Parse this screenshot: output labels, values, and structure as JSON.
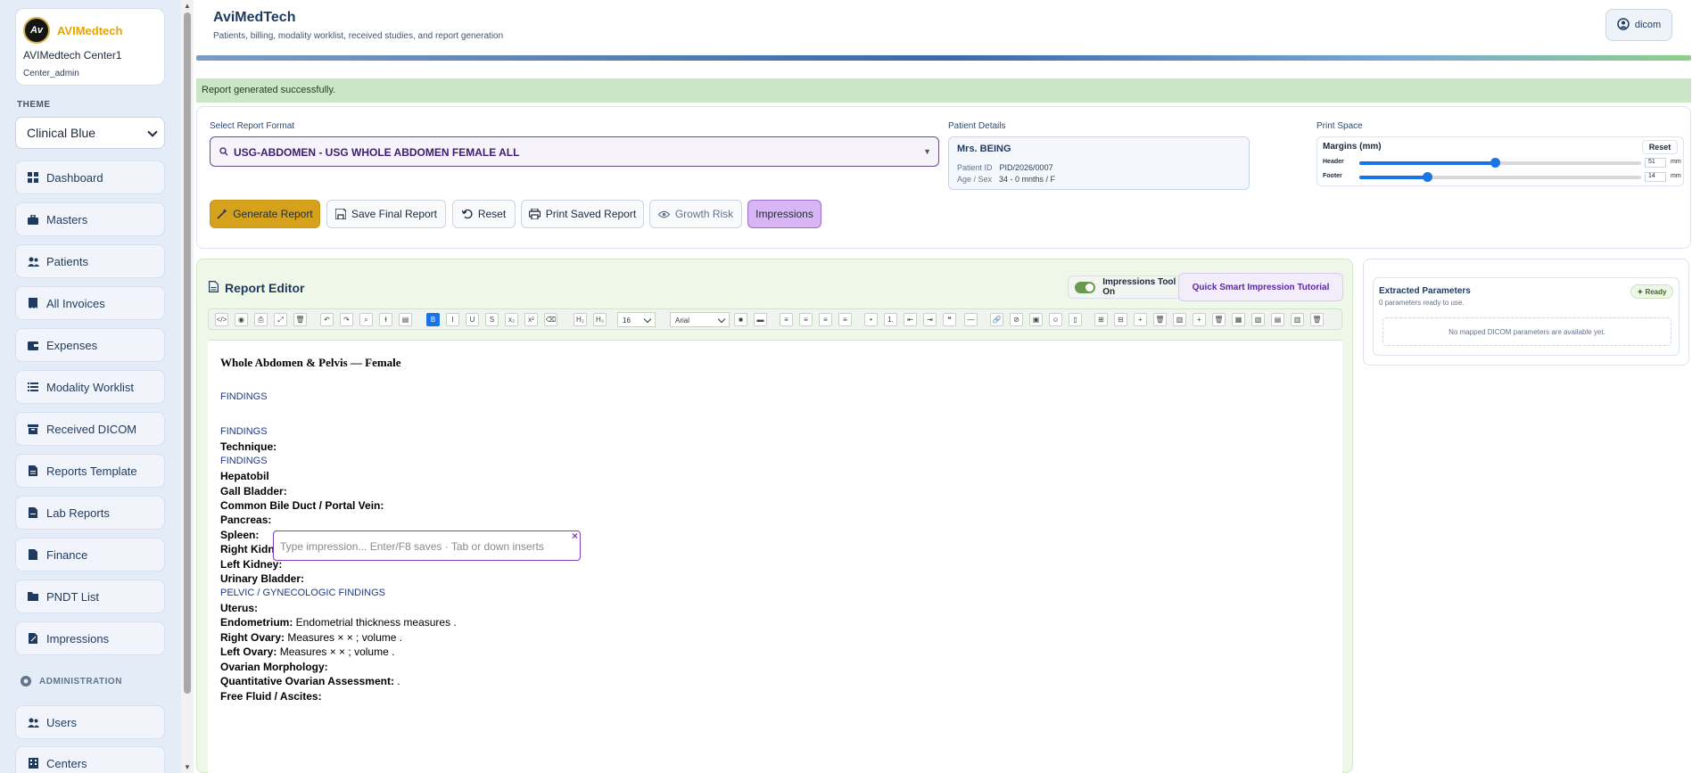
{
  "sidebar": {
    "brand": "AVIMedtech",
    "logo_text": "Av",
    "center_name": "AVIMedtech Center1",
    "role": "Center_admin",
    "theme_label": "THEME",
    "theme_value": "Clinical Blue",
    "nav": [
      {
        "label": "Dashboard",
        "icon": "dashboard-icon"
      },
      {
        "label": "Masters",
        "icon": "briefcase-icon"
      },
      {
        "label": "Patients",
        "icon": "users-icon"
      },
      {
        "label": "All Invoices",
        "icon": "invoice-icon"
      },
      {
        "label": "Expenses",
        "icon": "wallet-icon"
      },
      {
        "label": "Modality Worklist",
        "icon": "list-icon"
      },
      {
        "label": "Received DICOM",
        "icon": "box-icon"
      },
      {
        "label": "Reports Template",
        "icon": "document-icon"
      },
      {
        "label": "Lab Reports",
        "icon": "flask-icon"
      },
      {
        "label": "Finance",
        "icon": "money-icon"
      },
      {
        "label": "PNDT List",
        "icon": "folder-icon"
      },
      {
        "label": "Impressions",
        "icon": "pen-icon"
      }
    ],
    "admin_label": "ADMINISTRATION",
    "admin_nav": [
      {
        "label": "Users",
        "icon": "users-icon"
      },
      {
        "label": "Centers",
        "icon": "building-icon"
      }
    ]
  },
  "header": {
    "title": "AviMedTech",
    "subtitle": "Patients, billing, modality worklist, received studies, and report generation",
    "user": "dicom"
  },
  "alert": "Report generated successfully.",
  "report_format": {
    "label": "Select Report Format",
    "value": "USG-ABDOMEN - USG WHOLE ABDOMEN FEMALE ALL"
  },
  "patient": {
    "label": "Patient Details",
    "name": "Mrs. BEING",
    "id_label": "Patient ID",
    "id": "PID/2026/0007",
    "age_label": "Age / Sex",
    "age": "34 - 0 mnths / F"
  },
  "print_space": {
    "label": "Print Space",
    "margins_title": "Margins (mm)",
    "reset": "Reset",
    "header_label": "Header",
    "header_value": "51",
    "header_fraction": 0.48,
    "footer_label": "Footer",
    "footer_value": "14",
    "footer_fraction": 0.24,
    "unit": "mm"
  },
  "actions": {
    "generate": "Generate Report",
    "save": "Save Final Report",
    "reset": "Reset",
    "print": "Print Saved Report",
    "growth": "Growth Risk",
    "impressions": "Impressions"
  },
  "editor": {
    "title": "Report Editor",
    "toggle_label": "Impressions Tool On",
    "tutorial": "Quick Smart Impression Tutorial",
    "font_size": "16",
    "font_family": "Arial",
    "impression_placeholder": "Type impression... Enter/F8 saves · Tab or down inserts",
    "close": "×",
    "lines": {
      "title": "Whole Abdomen & Pelvis — Female",
      "findings1": "FINDINGS",
      "findings2": "FINDINGS",
      "technique": "Technique:",
      "findings3": "FINDINGS",
      "hepato": "Hepatobil",
      "gall": "Gall Bladder:",
      "cbd": "Common Bile Duct / Portal Vein:",
      "pancreas": "Pancreas:",
      "spleen": "Spleen:",
      "rkidney": "Right Kidney:",
      "lkidney": "Left Kidney:",
      "bladder": "Urinary Bladder:",
      "pelvic": "PELVIC / GYNECOLOGIC FINDINGS",
      "uterus": "Uterus:",
      "endo_label": "Endometrium:",
      "endo_text": " Endometrial thickness measures .",
      "rovary_label": "Right Ovary:",
      "rovary_text": " Measures × × ; volume .",
      "lovary_label": "Left Ovary:",
      "lovary_text": " Measures × × ; volume .",
      "morph": "Ovarian Morphology:",
      "quant_label": "Quantitative Ovarian Assessment:",
      "quant_text": " .",
      "fluid": "Free Fluid / Ascites:"
    }
  },
  "extracted": {
    "title": "Extracted Parameters",
    "subtitle": "0 parameters ready to use.",
    "badge": "Ready",
    "empty": "No mapped DICOM parameters are available yet."
  },
  "colors": {
    "accent": "#1a73e8",
    "brand": "#e8a400",
    "primary": "#1e3a5f",
    "generate_btn": "#d6a21c",
    "impressions_btn": "#d8b6f3",
    "success_bg": "#cbe6c7"
  }
}
